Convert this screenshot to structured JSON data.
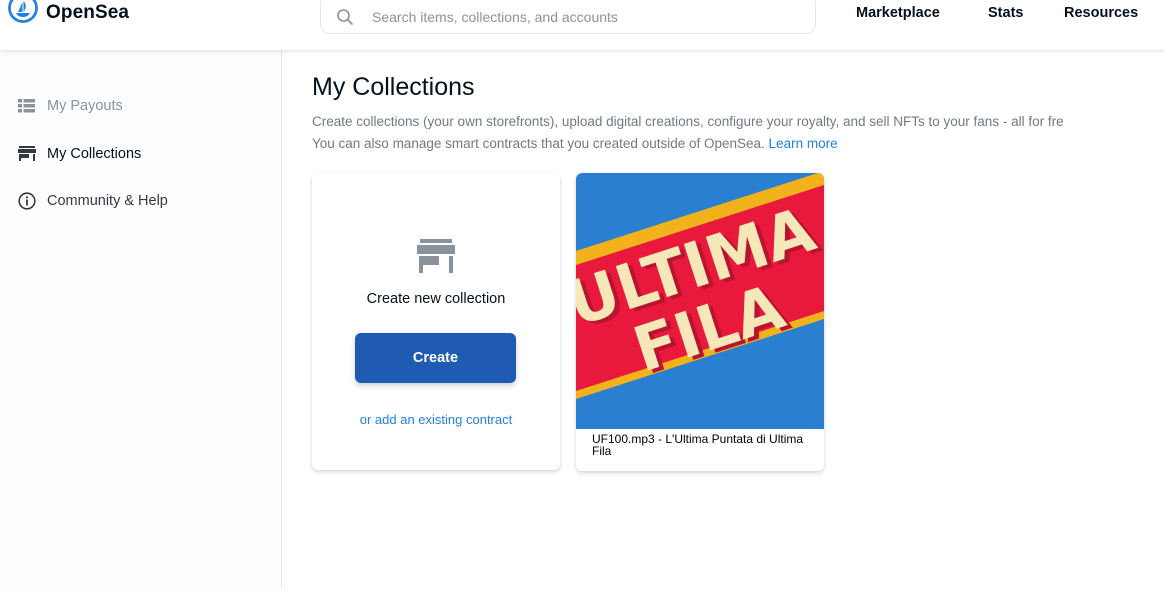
{
  "header": {
    "logo_text": "OpenSea",
    "search_placeholder": "Search items, collections, and accounts",
    "nav": [
      "Marketplace",
      "Stats",
      "Resources"
    ]
  },
  "sidebar": {
    "items": [
      {
        "label": "My Payouts",
        "icon": "list-icon"
      },
      {
        "label": "My Collections",
        "icon": "storefront-icon"
      },
      {
        "label": "Community & Help",
        "icon": "info-icon"
      }
    ]
  },
  "main": {
    "title": "My Collections",
    "desc_line1": "Create collections (your own storefronts), upload digital creations, configure your royalty, and sell NFTs to your fans - all for fre",
    "desc_line2": "You can also manage smart contracts that you created outside of OpenSea.",
    "learn_more": "Learn more"
  },
  "create_card": {
    "title": "Create new collection",
    "button_label": "Create",
    "link_label": "or add an existing contract"
  },
  "collections": [
    {
      "name": "UF100.mp3 - L'Ultima Puntata di Ultima Fila",
      "art_line1": "ULTIMA",
      "art_line2": "FILA"
    }
  ],
  "colors": {
    "accent": "#2081e2",
    "button": "#1f5bb3",
    "art_red": "#e8193c",
    "art_blue": "#2a7fd0",
    "art_yellow": "#f2b21c",
    "art_text": "#f6e7b8"
  }
}
